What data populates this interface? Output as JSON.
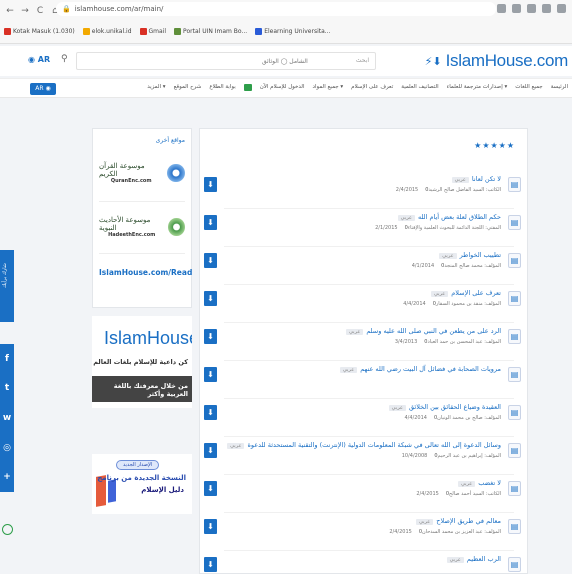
{
  "browser": {
    "nav_back": "←",
    "nav_forward": "→",
    "nav_reload": "C",
    "nav_home": "⌂",
    "url": "islamhouse.com/ar/main/",
    "bookmarks": [
      {
        "label": "Kotak Masuk (1.030)",
        "color": "#d93025"
      },
      {
        "label": "elok.unikal.id",
        "color": "#f2a900"
      },
      {
        "label": "Gmail",
        "color": "#d93025"
      },
      {
        "label": "Portal UIN Imam Bo...",
        "color": "#5f8f3a"
      },
      {
        "label": "Elearning Universita...",
        "color": "#2a5bd7"
      }
    ]
  },
  "header": {
    "lang_button": "AR",
    "search_placeholder": "ابحث",
    "search_scope": "الشامل ◯ الوثائق",
    "logo_text": "IslamHouse.com"
  },
  "menu": {
    "lang_select": "AR",
    "items": [
      "الرئيسة",
      "جميع اللغات",
      "إصدارات مترجمة للعلماء ▾",
      "التصانيف العلمية",
      "تعرف على الإسلام",
      "جميع المواد ▾",
      "الدخول للإسلام الآن",
      "بوابة الطلاع",
      "شرح الموقع",
      "المزيد ▾"
    ]
  },
  "sidebar": {
    "header": "مواقع أخرى",
    "cards": [
      {
        "arabic": "موسوعة القرآن الكريم",
        "english": "QuranEnc.com",
        "color": "#2a73c9"
      },
      {
        "arabic": "موسوعة الأحاديث النبوية",
        "english": "HadeethEnc.com",
        "color": "#4a9a4a"
      }
    ],
    "read_link": "IslamHouse.com/Read"
  },
  "banner1": {
    "logo": "IslamHouse.com",
    "subtitle": "كن داعية للإسلام بلغات العالم",
    "dark_text": "من خلال معرفتك باللغة العربية وأكثر"
  },
  "banner2": {
    "pill": "الإصدار الجديد",
    "line1": "النسخة الجديدة من برنامج",
    "line2": "دليل الإسلام"
  },
  "social": {
    "feedback": "شارك برأيك",
    "icons": [
      "f",
      "t",
      "w",
      "◎",
      "+"
    ]
  },
  "main": {
    "stars": "★★★★★",
    "items": [
      {
        "title": "لا تكن لعانا",
        "badge": "عربي",
        "meta": "الكاتب: السيد الفاضل صالح الرشيد",
        "date": "2/4/2015",
        "views": "0"
      },
      {
        "title": "حكم الطلاق لعلة بعض أيام الله",
        "badge": "عربي",
        "meta": "المفتي: اللجنة الدائمة للبحوث العلمية والإفتاء",
        "date": "2/1/2015",
        "views": "0"
      },
      {
        "title": "تطييب الخواطر",
        "badge": "عربي",
        "meta": "المؤلف: محمد صالح المنجد",
        "date": "4/1/2014",
        "views": "0"
      },
      {
        "title": "تعرف على الإسلام",
        "badge": "عربي",
        "meta": "المؤلف: منقذ بن محمود السقار",
        "date": "4/4/2014",
        "views": "0"
      },
      {
        "title": "الرد على من يطعن في النبي صلى الله عليه وسلم",
        "badge": "عربي",
        "meta": "المؤلف: عبد المحسن بن حمد العباد",
        "date": "3/4/2013",
        "views": "0"
      },
      {
        "title": "مرويات الصحابة في فضائل آل البيت رضي الله عنهم",
        "badge": "عربي",
        "meta": "",
        "date": "",
        "views": ""
      },
      {
        "title": "العقيدة وضياع الحقائق بين الخلائق",
        "badge": "عربي",
        "meta": "المؤلف: صالح بن محمد الونيان",
        "date": "4/4/2014",
        "views": "0"
      },
      {
        "title": "وسائل الدعوة إلى الله تعالى في شبكة المعلومات الدولية (الإنترنت) والتقنية المستحدثة للدعوة",
        "badge": "عربي",
        "meta": "المؤلف: إبراهيم بن عبد الرحيم",
        "date": "10/4/2008",
        "views": "0"
      },
      {
        "title": "لا تغضب",
        "badge": "عربي",
        "meta": "الكاتب: السيد أحمد صالح",
        "date": "2/4/2015",
        "views": "0"
      },
      {
        "title": "معالم في طريق الإصلاح",
        "badge": "عربي",
        "meta": "المؤلف: عبد العزيز بن محمد السدحان",
        "date": "2/4/2015",
        "views": "0"
      },
      {
        "title": "الرب العظيم",
        "badge": "عربي",
        "meta": "",
        "date": "",
        "views": ""
      }
    ]
  }
}
